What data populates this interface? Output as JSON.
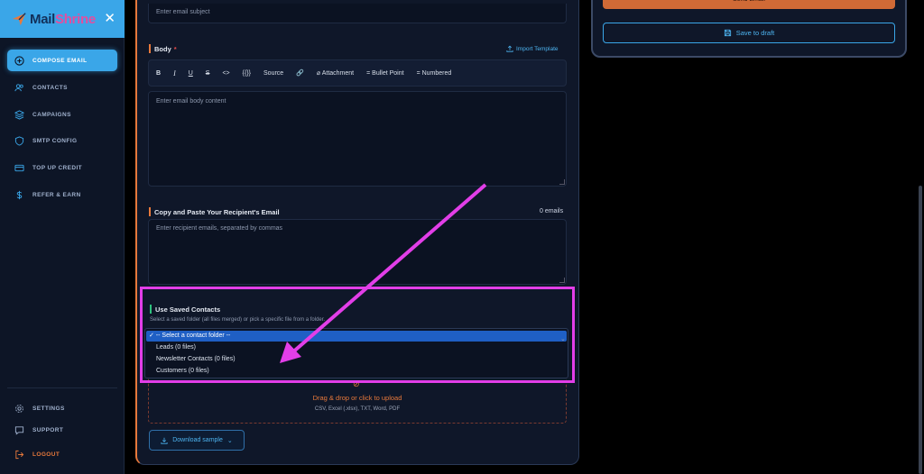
{
  "brand": {
    "name_part1": "Mail",
    "name_part2": "Shrine",
    "close_glyph": "✕"
  },
  "sidebar": {
    "items": [
      {
        "label": "COMPOSE EMAIL",
        "icon": "plus-circle-icon",
        "active": true
      },
      {
        "label": "CONTACTS",
        "icon": "users-icon"
      },
      {
        "label": "CAMPAIGNS",
        "icon": "layers-icon"
      },
      {
        "label": "SMTP CONFIG",
        "icon": "shield-icon"
      },
      {
        "label": "TOP UP CREDIT",
        "icon": "credit-card-icon"
      },
      {
        "label": "REFER & EARN",
        "icon": "dollar-icon"
      }
    ],
    "bottom_items": [
      {
        "label": "SETTINGS",
        "icon": "gear-icon"
      },
      {
        "label": "SUPPORT",
        "icon": "message-icon"
      },
      {
        "label": "LOGOUT",
        "icon": "logout-icon"
      }
    ]
  },
  "compose": {
    "subject_placeholder": "Enter email subject",
    "body_label": "Body",
    "required_mark": "*",
    "import_template": "Import Template",
    "toolbar": {
      "bold": "B",
      "italic": "I",
      "underline": "U",
      "strike": "S",
      "code": "<>",
      "variable": "{{}}",
      "source": "Source",
      "attachment": "Attachment",
      "bullet": "= Bullet Point",
      "numbered": "= Numbered"
    },
    "body_placeholder": "Enter email body content",
    "recipients_label": "Copy and Paste Your Recipient's Email",
    "email_count": "0 emails",
    "recipients_placeholder": "Enter recipient emails, separated by commas",
    "saved_contacts_label": "Use Saved Contacts",
    "saved_contacts_help": "Select a saved folder (all files merged) or pick a specific file from a folder.",
    "folder_options": [
      "✓ -- Select a contact folder --",
      "Leads (0 files)",
      "Newsletter Contacts (0 files)",
      "Customers (0 files)"
    ],
    "dropzone_title": "Drag & drop or click to upload",
    "dropzone_formats": "CSV, Excel (.xlsx), TXT, Word, PDF",
    "download_sample": "Download sample"
  },
  "actions": {
    "send_email": "Send Email",
    "save_draft": "Save to draft"
  },
  "colors": {
    "accent_blue": "#3aa6e8",
    "accent_orange": "#e8793b",
    "annotation_magenta": "#e23ee8"
  }
}
